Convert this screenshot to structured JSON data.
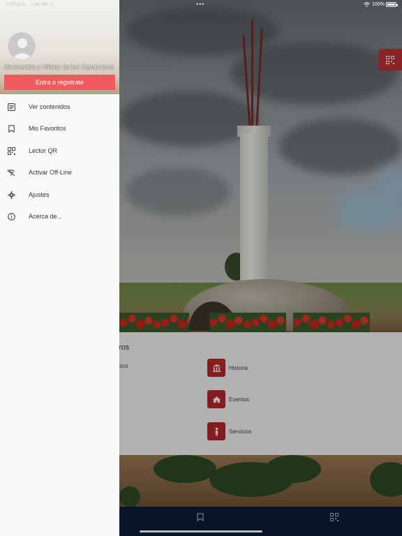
{
  "status_bar": {
    "time": "5:25 p.m.",
    "date": "Lun abr. 4",
    "dots": "•••",
    "battery": "100%",
    "battery_level_percent": 100
  },
  "drawer": {
    "welcome_text": "Bienvenido a Villalar de los Comuneros",
    "login_button": "Entra o registrate",
    "items": [
      {
        "label": "Ver contenidos",
        "icon": "list-document-icon"
      },
      {
        "label": "Mis Favoritos",
        "icon": "bookmark-icon"
      },
      {
        "label": "Lector QR",
        "icon": "qr-code-icon"
      },
      {
        "label": "Activar Off-Line",
        "icon": "wifi-off-icon"
      },
      {
        "label": "Ajustes",
        "icon": "gear-icon"
      },
      {
        "label": "Acerca de...",
        "icon": "info-icon"
      }
    ]
  },
  "main": {
    "section_title_partial": "ros",
    "left_category_partial": "sco",
    "categories": [
      {
        "label": "Historia",
        "icon": "museum-icon"
      },
      {
        "label": "Eventos",
        "icon": "event-tent-icon"
      },
      {
        "label": "Servicios",
        "icon": "person-service-icon"
      }
    ]
  },
  "bottom_bar": {
    "items": [
      "bookmark-icon",
      "qr-code-icon"
    ]
  },
  "colors": {
    "accent_red": "#ef5b5f",
    "category_red": "#b8282e",
    "bottom_bar_navy": "#0c1c3a"
  }
}
